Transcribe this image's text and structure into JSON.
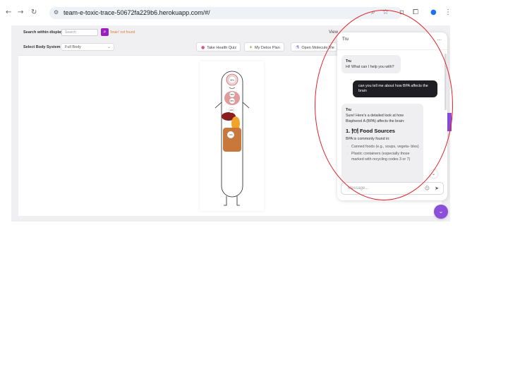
{
  "browser": {
    "url": "team-e-toxic-trace-50672fa229b6.herokuapp.com/#/"
  },
  "toolbar": {
    "search_label": "Search within display",
    "search_placeholder": "Search",
    "not_found_text": "'brain' not found",
    "body_system_label": "Select Body System:",
    "body_system_value": "Full Body",
    "quiz_label": "Take Health Quiz",
    "detox_label": "My Detox Plan",
    "molecule_label": "Open Molecule Vie",
    "view_label": "View"
  },
  "body_map": {
    "organ_labels": [
      "58%",
      "58%",
      "68%",
      "42%",
      "72%",
      "92%"
    ]
  },
  "chat": {
    "title": "Tru",
    "more": "...",
    "msg1_sender": "Tru",
    "msg1_text": "Hi! What can I help you with?",
    "user_msg": "can you tell me about how BPA affects the brain",
    "msg2_sender": "Tru",
    "msg2_intro": "Sure! Here's a detailed look at how Bisphenol A (BPA) affects the brain:",
    "food_heading": "1. 🍽 Food Sources",
    "food_intro": "BPA is commonly found in:",
    "food_items": [
      "Canned foods (e.g., soups, vegeta- bles)",
      "Plastic containers (especially those marked with recycling codes 3 or 7)"
    ],
    "input_placeholder": "Message..."
  },
  "colors": {
    "accent": "#8b4fd9",
    "search_button": "#9b1fbf",
    "annotation": "#e2222a"
  }
}
